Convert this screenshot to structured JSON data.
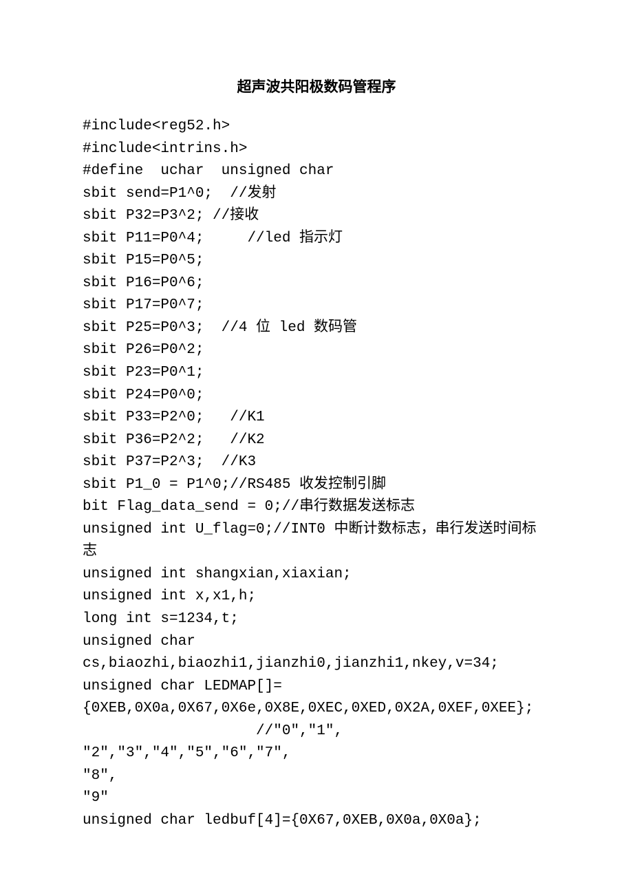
{
  "title": "超声波共阳极数码管程序",
  "lines": [
    "#include<reg52.h>",
    "#include<intrins.h>",
    "#define  uchar  unsigned char",
    "sbit send=P1^0;  //发射",
    "sbit P32=P3^2; //接收",
    "sbit P11=P0^4;     //led 指示灯",
    "sbit P15=P0^5;",
    "sbit P16=P0^6;",
    "sbit P17=P0^7;",
    "sbit P25=P0^3;  //4 位 led 数码管",
    "sbit P26=P0^2;",
    "sbit P23=P0^1;",
    "sbit P24=P0^0;",
    "sbit P33=P2^0;   //K1",
    "sbit P36=P2^2;   //K2",
    "sbit P37=P2^3;  //K3",
    "sbit P1_0 = P1^0;//RS485 收发控制引脚",
    "bit Flag_data_send = 0;//串行数据发送标志",
    "unsigned int U_flag=0;//INT0 中断计数标志，串行发送时间标志",
    "unsigned int shangxian,xiaxian;",
    "unsigned int x,x1,h;",
    "long int s=1234,t;",
    "unsigned char",
    "cs,biaozhi,biaozhi1,jianzhi0,jianzhi1,nkey,v=34;",
    "unsigned char LEDMAP[]=",
    "{0XEB,0X0a,0X67,0X6e,0X8E,0XEC,0XED,0X2A,0XEF,0XEE};",
    "                    //\"0\",\"1\",  \"2\",\"3\",\"4\",\"5\",\"6\",\"7\",",
    "\"8\",",
    "\"9\"",
    "unsigned char ledbuf[4]={0X67,0XEB,0X0a,0X0a};"
  ]
}
